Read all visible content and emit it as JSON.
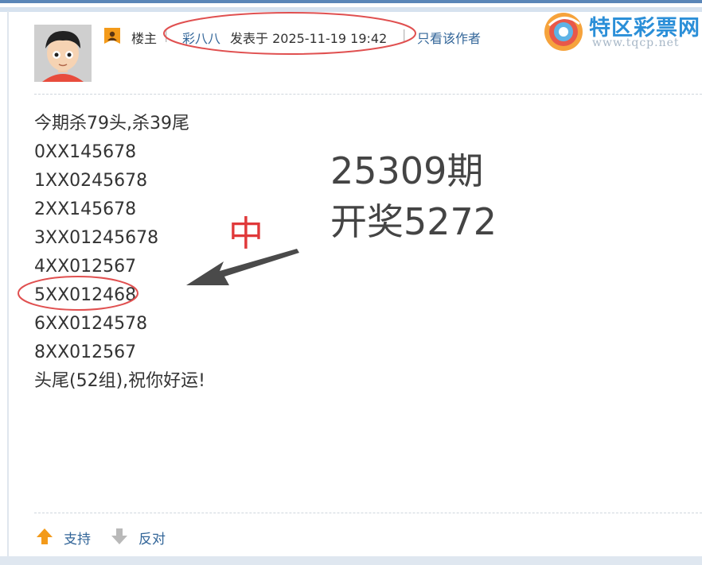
{
  "post_header": {
    "role": "楼主",
    "author": "彩八八",
    "posted": "发表于 2025-11-19 19:42",
    "only_author": "只看该作者"
  },
  "site_logo": {
    "title": "特区彩票网",
    "url": "www.tqcp.net"
  },
  "content": {
    "lines": [
      "今期杀79头,杀39尾",
      "0XX145678",
      "1XX0245678",
      "2XX145678",
      "3XX01245678",
      "4XX012567",
      "5XX012468",
      "6XX0124578",
      "8XX012567",
      "头尾(52组),祝你好运!"
    ]
  },
  "annotation": {
    "period": "25309期",
    "draw": "开奖5272",
    "hit": "中"
  },
  "footer": {
    "support": "支持",
    "oppose": "反对"
  },
  "colors": {
    "link": "#336699",
    "annotation_red": "#e0393a",
    "top_bar": "#5a86b8"
  }
}
